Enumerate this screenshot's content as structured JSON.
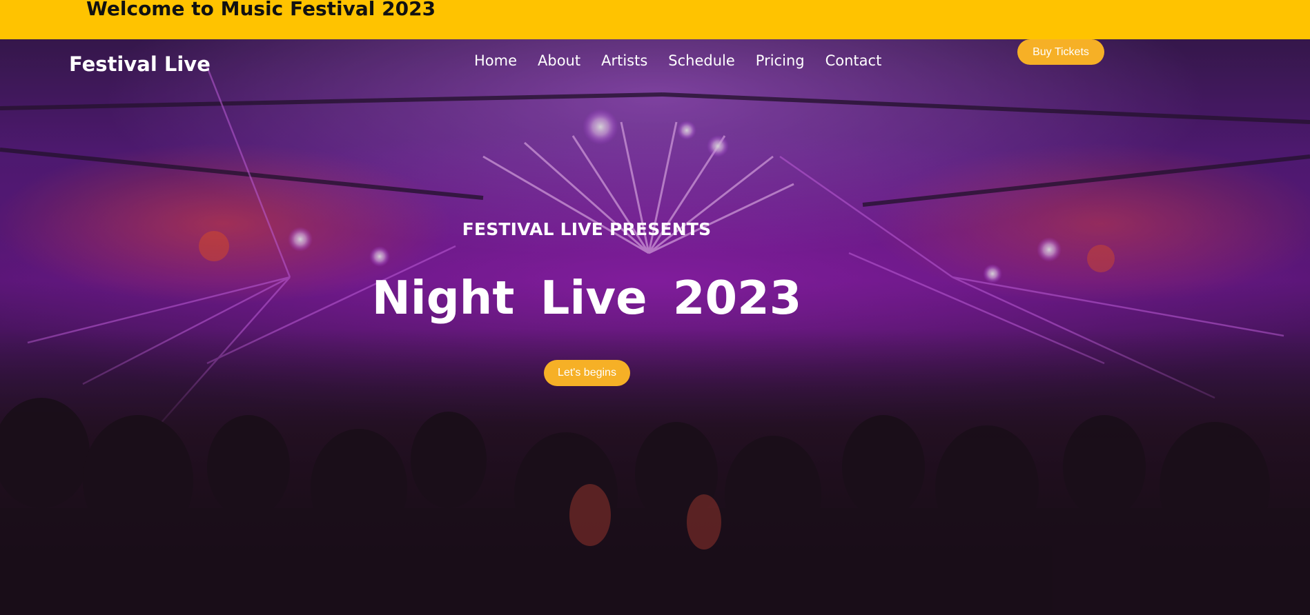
{
  "banner": {
    "text": "Welcome to Music Festival 2023"
  },
  "header": {
    "logo": "Festival Live",
    "nav": [
      {
        "label": "Home"
      },
      {
        "label": "About"
      },
      {
        "label": "Artists"
      },
      {
        "label": "Schedule"
      },
      {
        "label": "Pricing"
      },
      {
        "label": "Contact"
      }
    ],
    "cta_label": "Buy Tickets"
  },
  "hero": {
    "eyebrow": "FESTIVAL LIVE PRESENTS",
    "title": "Night Live 2023",
    "button_label": "Let's begins"
  },
  "colors": {
    "banner_bg": "#ffc300",
    "accent": "#f6b026",
    "hero_purple": "#6a1a8c",
    "text": "#ffffff"
  }
}
